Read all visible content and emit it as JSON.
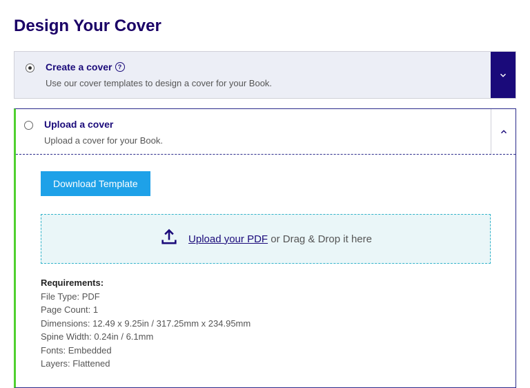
{
  "title": "Design Your Cover",
  "options": {
    "create": {
      "title": "Create a cover",
      "desc": "Use our cover templates to design a cover for your Book."
    },
    "upload": {
      "title": "Upload a cover",
      "desc": "Upload a cover for your Book."
    }
  },
  "buttons": {
    "download_template": "Download Template"
  },
  "dropzone": {
    "link": "Upload your PDF",
    "rest": " or Drag & Drop it here"
  },
  "requirements": {
    "heading": "Requirements:",
    "file_type": "File Type: PDF",
    "page_count": "Page Count: 1",
    "dimensions": "Dimensions: 12.49 x 9.25in / 317.25mm x 234.95mm",
    "spine_width": "Spine Width: 0.24in / 6.1mm",
    "fonts": "Fonts: Embedded",
    "layers": "Layers: Flattened"
  }
}
